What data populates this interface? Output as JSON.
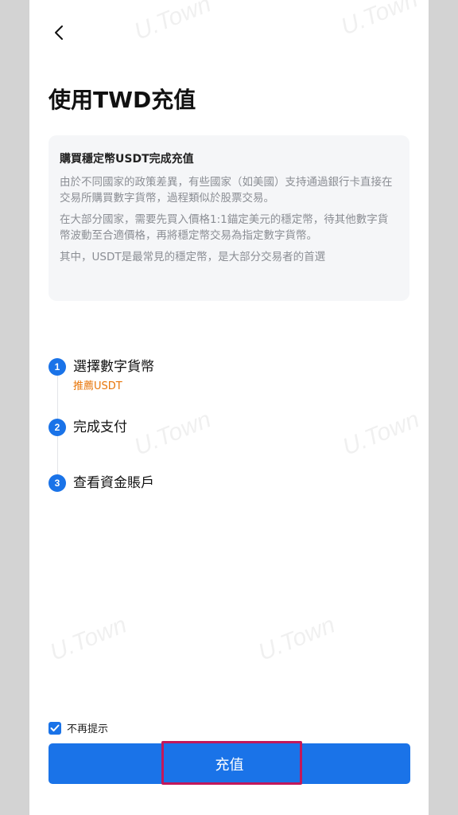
{
  "header": {
    "back_icon": "chevron-left-icon",
    "title": "使用TWD充值"
  },
  "info_card": {
    "title": "購買穩定幣USDT完成充值",
    "paragraphs": [
      "由於不同國家的政策差異，有些國家（如美國）支持通過銀行卡直接在交易所購買數字貨幣，過程類似於股票交易。",
      "在大部分國家，需要先買入價格1:1錨定美元的穩定幣，待其他數字貨幣波動至合適價格，再將穩定幣交易為指定數字貨幣。",
      "其中，USDT是最常見的穩定幣，是大部分交易者的首選"
    ]
  },
  "steps": [
    {
      "number": "1",
      "label": "選擇數字貨幣",
      "sub": "推薦USDT"
    },
    {
      "number": "2",
      "label": "完成支付"
    },
    {
      "number": "3",
      "label": "查看資金賬戶"
    }
  ],
  "footer": {
    "dont_show_label": "不再提示",
    "dont_show_checked": true,
    "button_label": "充值"
  },
  "watermark_text": "U.Town",
  "colors": {
    "primary": "#1a73e8",
    "accent_orange": "#e8760a",
    "highlight": "#c2185b",
    "card_bg": "#f5f6f8",
    "side_bg": "#d3d3d3"
  }
}
